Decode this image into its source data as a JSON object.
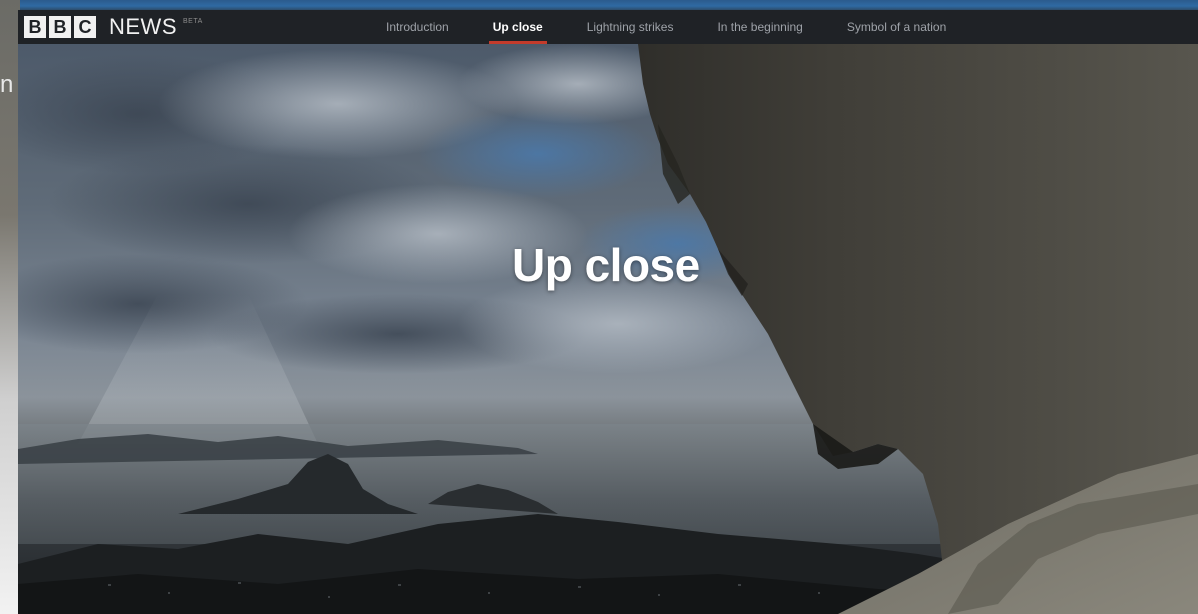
{
  "header": {
    "logo_letters": [
      "B",
      "B",
      "C"
    ],
    "logo_news": "NEWS",
    "logo_beta": "BETA"
  },
  "nav": {
    "items": [
      {
        "label": "Introduction",
        "active": false
      },
      {
        "label": "Up close",
        "active": true
      },
      {
        "label": "Lightning strikes",
        "active": false
      },
      {
        "label": "In the beginning",
        "active": false
      },
      {
        "label": "Symbol of a nation",
        "active": false
      }
    ]
  },
  "hero": {
    "title": "Up close"
  },
  "colors": {
    "header_bg": "#1f2226",
    "nav_active_underline": "#c43b2b",
    "nav_inactive_text": "#9ea2a8"
  }
}
